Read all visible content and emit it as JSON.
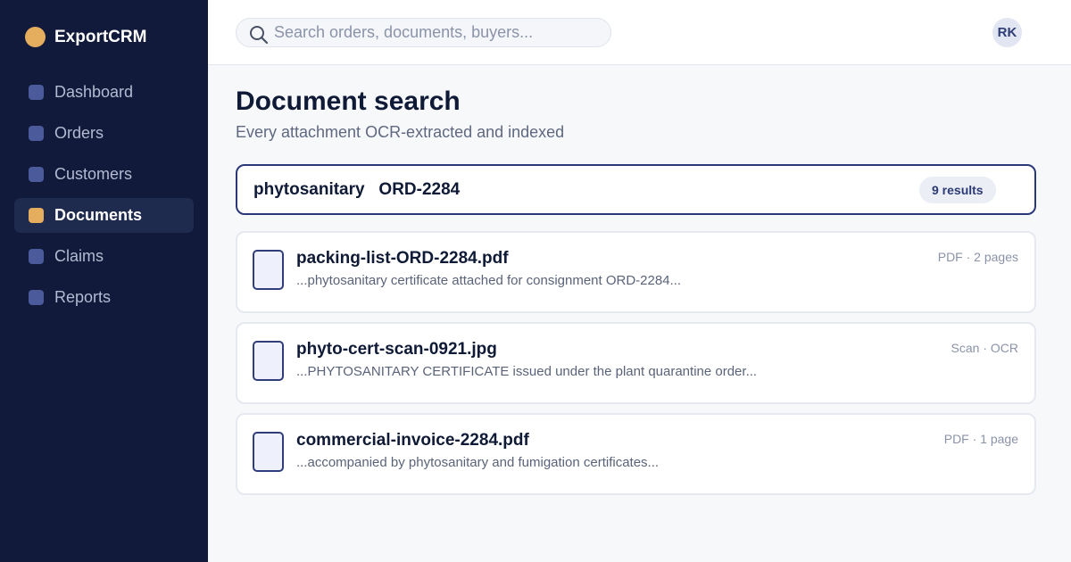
{
  "app": {
    "name": "ExportCRM",
    "accent_color": "#e5ad5e",
    "sidebar_color": "#111a3b"
  },
  "sidebar": {
    "items": [
      {
        "label": "Dashboard",
        "icon": "dashboard-icon",
        "active": false
      },
      {
        "label": "Orders",
        "icon": "orders-icon",
        "active": false
      },
      {
        "label": "Customers",
        "icon": "customers-icon",
        "active": false
      },
      {
        "label": "Documents",
        "icon": "documents-icon",
        "active": true
      },
      {
        "label": "Claims",
        "icon": "claims-icon",
        "active": false
      },
      {
        "label": "Reports",
        "icon": "reports-icon",
        "active": false
      }
    ]
  },
  "topbar": {
    "search_placeholder": "Search orders, documents, buyers...",
    "search_value": "",
    "avatar_initials": "RK"
  },
  "main": {
    "title": "Document search",
    "subtitle": "Every attachment OCR-extracted and indexed",
    "query": "phytosanitary   ORD-2284",
    "results_count": "9 results",
    "results": [
      {
        "name": "packing-list-ORD-2284.pdf",
        "snippet": "...phytosanitary certificate attached for consignment ORD-2284...",
        "meta": "PDF · 2 pages",
        "icon": "pdf-file-icon"
      },
      {
        "name": "phyto-cert-scan-0921.jpg",
        "snippet": "...PHYTOSANITARY CERTIFICATE issued under the plant quarantine order...",
        "meta": "Scan · OCR",
        "icon": "image-file-icon"
      },
      {
        "name": "commercial-invoice-2284.pdf",
        "snippet": "...accompanied by phytosanitary and fumigation certificates...",
        "meta": "PDF · 1 page",
        "icon": "pdf-file-icon"
      }
    ]
  }
}
